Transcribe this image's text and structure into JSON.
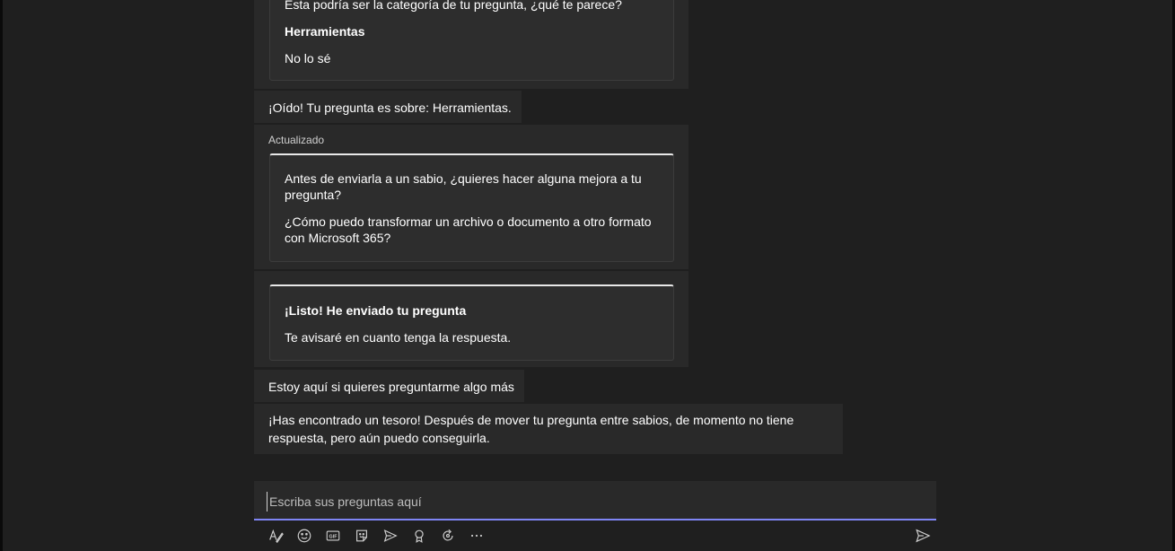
{
  "messages": {
    "category_card": {
      "question": "Esta podría ser la categoría de tu pregunta, ¿qué te parece?",
      "category": "Herramientas",
      "alternative": "No lo sé"
    },
    "heard": "¡Oído! Tu pregunta es sobre: Herramientas.",
    "updated_label": "Actualizado",
    "improve_card": {
      "prompt": "Antes de enviarla a un sabio, ¿quieres hacer alguna mejora a tu pregunta?",
      "question": "¿Cómo puedo transformar un archivo o documento a otro formato con Microsoft 365?"
    },
    "sent_card": {
      "title": "¡Listo! He enviado tu pregunta",
      "body": "Te avisaré en cuanto tenga la respuesta."
    },
    "here": "Estoy aquí si quieres preguntarme algo más",
    "treasure": "¡Has encontrado un tesoro! Después de mover tu pregunta entre sabios, de momento no tiene respuesta, pero aún puedo conseguirla."
  },
  "compose": {
    "placeholder": "Escriba sus preguntas aquí"
  },
  "toolbar": {
    "icons": [
      "format-icon",
      "emoji-icon",
      "gif-icon",
      "sticker-icon",
      "schedule-meeting-icon",
      "praise-icon",
      "loop-icon",
      "more-icon",
      "send-icon"
    ]
  },
  "colors": {
    "background": "#1f1f1f",
    "bubble": "#292929",
    "card": "#2d2d2d",
    "accent": "#7f85f5"
  }
}
